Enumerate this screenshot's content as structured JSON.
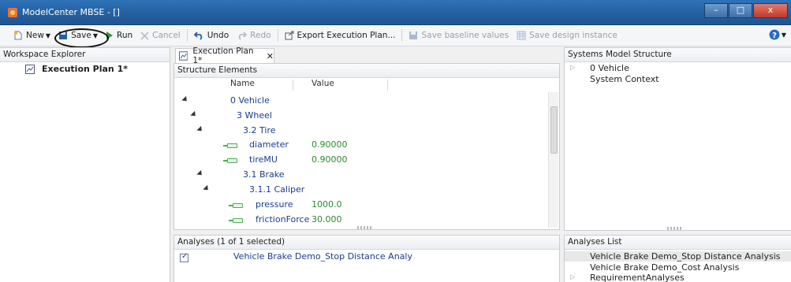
{
  "window": {
    "title": "ModelCenter MBSE - []",
    "min": "–",
    "max": "□",
    "close": "x"
  },
  "toolbar": {
    "new_label": "New",
    "save_label": "Save",
    "run_label": "Run",
    "cancel_label": "Cancel",
    "undo_label": "Undo",
    "redo_label": "Redo",
    "export_label": "Export Execution Plan...",
    "save_baseline_label": "Save baseline values",
    "save_design_label": "Save design instance"
  },
  "workspace": {
    "title": "Workspace Explorer",
    "item": "Execution Plan 1*"
  },
  "editor": {
    "tab_label": "Execution Plan 1*",
    "structure_title": "Structure Elements",
    "col_name": "Name",
    "col_value": "Value",
    "rows": [
      {
        "name": "0 Vehicle",
        "value": ""
      },
      {
        "name": "3 Wheel",
        "value": ""
      },
      {
        "name": "3.2 Tire",
        "value": ""
      },
      {
        "name": "diameter",
        "value": "0.90000"
      },
      {
        "name": "tireMU",
        "value": "0.90000"
      },
      {
        "name": "3.1 Brake",
        "value": ""
      },
      {
        "name": "3.1.1 Caliper",
        "value": ""
      },
      {
        "name": "pressure",
        "value": "1000.0"
      },
      {
        "name": "frictionForce",
        "value": "30.000"
      }
    ]
  },
  "analyses": {
    "title": "Analyses (1 of 1 selected)",
    "item": "Vehicle Brake Demo_Stop Distance Analy"
  },
  "systems": {
    "title": "Systems Model Structure",
    "items": [
      "0 Vehicle",
      "System Context"
    ]
  },
  "analyses_list": {
    "title": "Analyses List",
    "items": [
      "Vehicle Brake Demo_Stop Distance Analysis",
      "Vehicle Brake Demo_Cost Analysis",
      "RequirementAnalyses"
    ]
  },
  "colors": {
    "title_bar": "#245f9f",
    "tree_text": "#1a3d8f",
    "value_text": "#2b8a2b",
    "save_highlight": "#111111"
  }
}
